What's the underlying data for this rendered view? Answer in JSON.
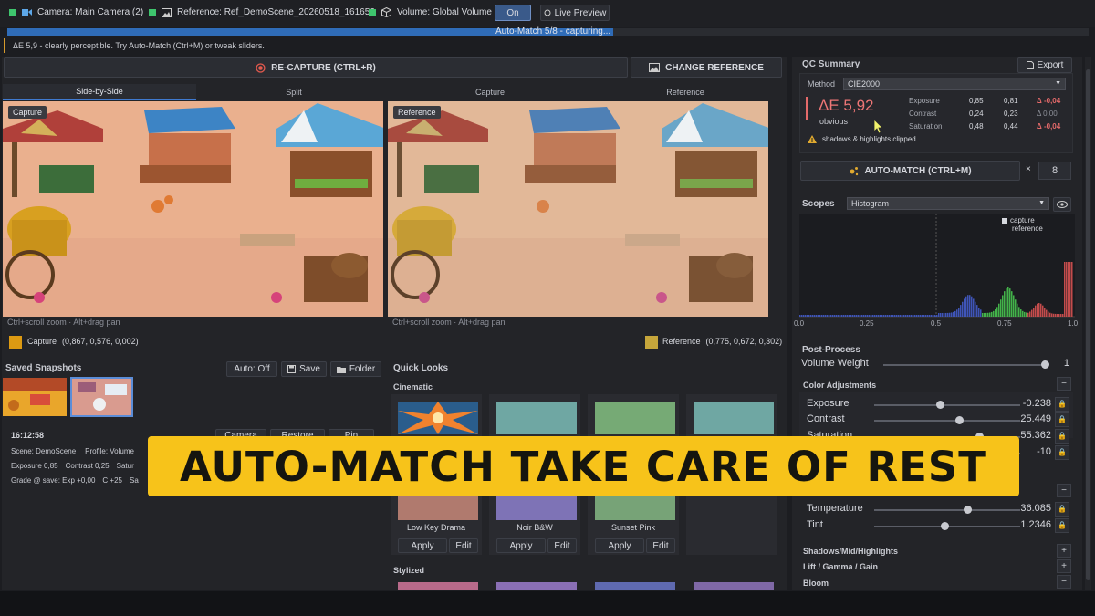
{
  "topbar": {
    "camera": "Camera: Main Camera (2)",
    "reference": "Reference: Ref_DemoScene_20260518_161656",
    "volume": "Volume: Global Volume",
    "on_label": "On",
    "live_preview": "Live Preview"
  },
  "progress": {
    "text": "Auto-Match 5/8 - capturing...",
    "fraction": 0.56
  },
  "message": "ΔE 5,9 - clearly perceptible. Try Auto-Match (Ctrl+M) or tweak sliders.",
  "toolbar": {
    "recapture": "RE-CAPTURE (CTRL+R)",
    "change_reference": "CHANGE REFERENCE"
  },
  "tabs": [
    "Side-by-Side",
    "Split",
    "Capture",
    "Reference"
  ],
  "viewports": {
    "capture_label": "Capture",
    "reference_label": "Reference",
    "hint": "Ctrl+scroll zoom · Alt+drag pan"
  },
  "pickers": {
    "capture": {
      "label": "Capture",
      "value": "(0,867, 0,576, 0,002)",
      "color": "#dd9a12"
    },
    "reference": {
      "label": "Reference",
      "value": "(0,775, 0,672, 0,302)",
      "color": "#c6a63b"
    }
  },
  "snapshots": {
    "title": "Saved Snapshots",
    "auto_off": "Auto: Off",
    "save": "Save",
    "folder": "Folder",
    "time": "16:12:58",
    "camera_btn": "Camera",
    "restore_btn": "Restore",
    "pin_btn": "Pin",
    "scene": "Scene: DemoScene",
    "profile": "Profile: Volume",
    "exposure": "Exposure 0,85",
    "contrast": "Contrast 0,25",
    "saturation": "Satur",
    "grade": "Grade @ save: Exp +0,00",
    "grade_c": "C +25",
    "grade_s": "Sa"
  },
  "quick_looks": {
    "title": "Quick Looks",
    "cinematic": "Cinematic",
    "stylized": "Stylized",
    "looks": [
      {
        "name": "Low Key Drama",
        "top_color": "#6fa7a3",
        "bottom_color": "#b07a6e"
      },
      {
        "name": "Noir B&W",
        "top_color": "#6fa7a3",
        "bottom_color": "#7e73b6"
      },
      {
        "name": "Sunset Pink",
        "top_color": "#76aa75",
        "bottom_color": "#77a377"
      },
      {
        "name": "",
        "top_color": "#6fa7a3",
        "bottom_color": ""
      }
    ],
    "apply": "Apply",
    "edit": "Edit"
  },
  "qc": {
    "title": "QC Summary",
    "export": "Export",
    "method_label": "Method",
    "method": "CIE2000",
    "delta": "ΔE 5,92",
    "delta_desc": "obvious",
    "rows": [
      {
        "name": "Exposure",
        "a": "0,85",
        "b": "0,81",
        "d": "Δ -0,04"
      },
      {
        "name": "Contrast",
        "a": "0,24",
        "b": "0,23",
        "d": "Δ 0,00"
      },
      {
        "name": "Saturation",
        "a": "0,48",
        "b": "0,44",
        "d": "Δ -0,04"
      }
    ],
    "warning": "shadows & highlights clipped",
    "automatch": "AUTO-MATCH (CTRL+M)",
    "times": "×",
    "iterations": "8"
  },
  "scopes": {
    "title": "Scopes",
    "mode": "Histogram",
    "legend_capture": "capture",
    "legend_reference": "reference",
    "ticks": [
      "0.0",
      "0.25",
      "0.5",
      "0.75",
      "1.0"
    ]
  },
  "postprocess": {
    "title": "Post-Process",
    "volume_weight_label": "Volume Weight",
    "volume_weight": "1",
    "color_adjustments": "Color Adjustments",
    "sliders": [
      {
        "label": "Exposure",
        "value": "-0.238",
        "pos": 0.45
      },
      {
        "label": "Contrast",
        "value": "25.449",
        "pos": 0.58
      },
      {
        "label": "Saturation",
        "value": "55.362",
        "pos": 0.72
      },
      {
        "label": "",
        "value": "-10",
        "pos": 0.6
      }
    ],
    "temperature_label": "Temperature",
    "temperature": "36.085",
    "tint_label": "Tint",
    "tint": "1.2346",
    "sections": [
      "Shadows/Mid/Highlights",
      "Lift / Gamma / Gain",
      "Bloom"
    ]
  },
  "banner": "AUTO-MATCH TAKE CARE OF REST",
  "colors": {
    "accent": "#2f6cb8",
    "banner": "#f7c31a",
    "delta": "#e46a6a",
    "warn": "#e0a92f"
  }
}
